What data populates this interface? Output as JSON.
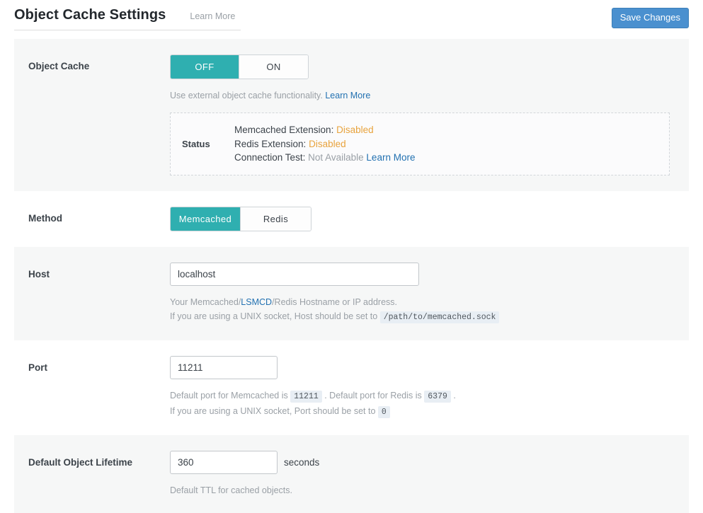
{
  "header": {
    "title": "Object Cache Settings",
    "learn_more": "Learn More",
    "save_label": "Save Changes"
  },
  "colors": {
    "accent_teal": "#2fafb0",
    "primary_blue": "#4a90cf",
    "warning_orange": "#e8a33d",
    "link_blue": "#2271b1",
    "muted_gray": "#9aa0a6",
    "row_shaded": "#f6f7f7"
  },
  "rows": {
    "object_cache": {
      "label": "Object Cache",
      "toggle": {
        "options": [
          "OFF",
          "ON"
        ],
        "selected": "OFF"
      },
      "desc_text": "Use external object cache functionality.",
      "desc_link": "Learn More",
      "status": {
        "title": "Status",
        "lines": [
          {
            "label": "Memcached Extension:",
            "value": "Disabled",
            "state": "disabled"
          },
          {
            "label": "Redis Extension:",
            "value": "Disabled",
            "state": "disabled"
          },
          {
            "label": "Connection Test:",
            "value": "Not Available",
            "state": "na",
            "link": "Learn More"
          }
        ]
      }
    },
    "method": {
      "label": "Method",
      "toggle": {
        "options": [
          "Memcached",
          "Redis"
        ],
        "selected": "Memcached"
      }
    },
    "host": {
      "label": "Host",
      "value": "localhost",
      "placeholder": "localhost",
      "desc_line1_pre": "Your Memcached/",
      "desc_line1_link": "LSMCD",
      "desc_line1_post": "/Redis Hostname or IP address.",
      "desc_line2_pre": "If you are using a UNIX socket, Host should be set to",
      "desc_line2_code": "/path/to/memcached.sock"
    },
    "port": {
      "label": "Port",
      "value": "11211",
      "placeholder": "11211",
      "desc_line1_pre": "Default port for Memcached is",
      "desc_line1_code1": "11211",
      "desc_line1_mid": ". Default port for Redis is",
      "desc_line1_code2": "6379",
      "desc_line1_post": ".",
      "desc_line2_pre": "If you are using a UNIX socket, Port should be set to",
      "desc_line2_code": "0"
    },
    "lifetime": {
      "label": "Default Object Lifetime",
      "value": "360",
      "placeholder": "360",
      "unit": "seconds",
      "desc": "Default TTL for cached objects."
    }
  }
}
